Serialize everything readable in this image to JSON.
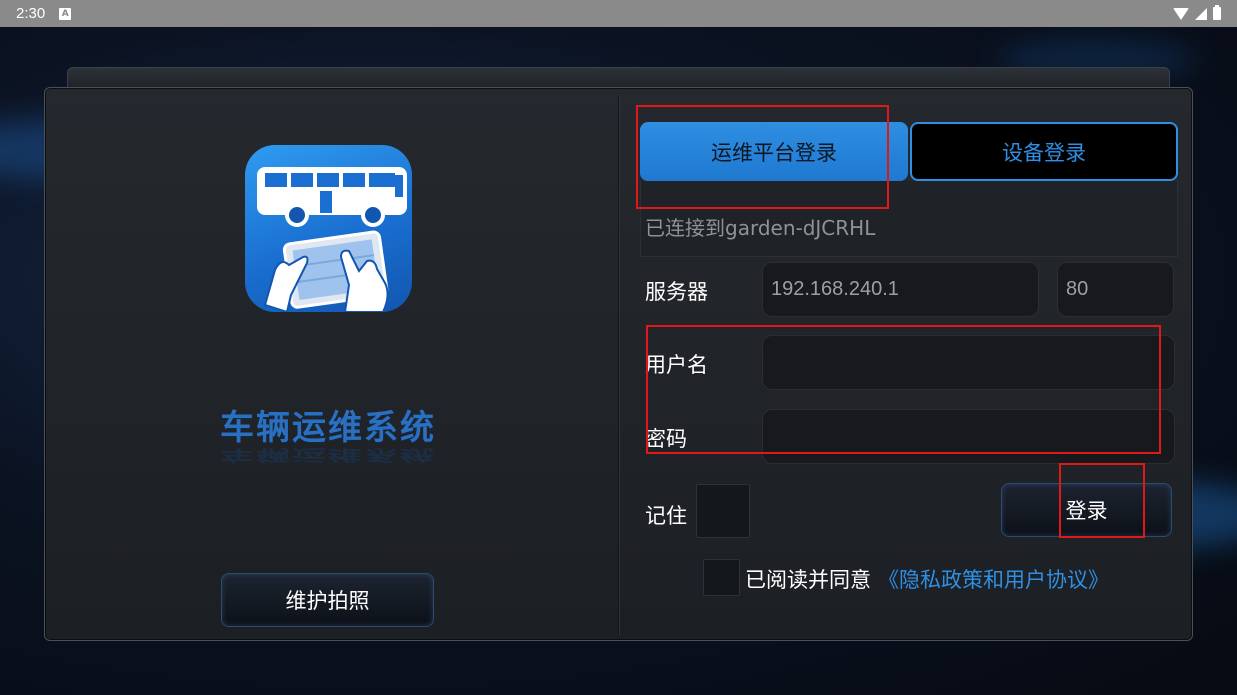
{
  "status_bar": {
    "time": "2:30",
    "icons": [
      "app-notification-icon",
      "wifi-icon",
      "signal-icon",
      "battery-icon"
    ]
  },
  "app": {
    "title": "车辆运维系统",
    "logo": "bus-tablet-logo-icon"
  },
  "left": {
    "photo_button": "维护拍照"
  },
  "tabs": {
    "ops_platform": "运维平台登录",
    "device": "设备登录",
    "active": "运维平台登录"
  },
  "connection": {
    "status": "已连接到garden-dJCRHL"
  },
  "form": {
    "server_label": "服务器",
    "server_value": "192.168.240.1",
    "port_value": "80",
    "username_label": "用户名",
    "username_value": "",
    "password_label": "密码",
    "password_value": "",
    "remember_label": "记住",
    "remember_checked": false,
    "login_button": "登录"
  },
  "agreement": {
    "text": "已阅读并同意",
    "link": "《隐私政策和用户协议》",
    "checked": false
  },
  "colors": {
    "accent": "#2e8fe4",
    "annotation": "#e01818"
  }
}
